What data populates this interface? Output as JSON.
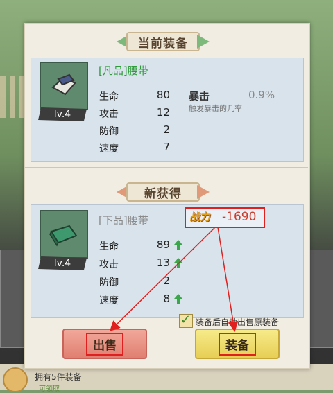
{
  "header": {
    "current_title": "当前装备",
    "new_title": "新获得"
  },
  "current_item": {
    "name": "[凡品]腰带",
    "name_color": "#2e9a3a",
    "level": "lv.4",
    "stats": [
      {
        "label": "生命",
        "value": "80"
      },
      {
        "label": "攻击",
        "value": "12"
      },
      {
        "label": "防御",
        "value": "2"
      },
      {
        "label": "速度",
        "value": "7"
      }
    ],
    "crit": {
      "label": "暴击",
      "value": "0.9%",
      "desc": "触发暴击的几率"
    }
  },
  "new_item": {
    "name": "[下品]腰带",
    "name_color": "#8a8a8a",
    "level": "lv.4",
    "power_label": "战力",
    "power_value": "-1690",
    "stats": [
      {
        "label": "生命",
        "value": "89",
        "icon": "up-arrow-icon"
      },
      {
        "label": "攻击",
        "value": "13",
        "icon": "up-arrow-icon"
      },
      {
        "label": "防御",
        "value": "2"
      },
      {
        "label": "速度",
        "value": "8",
        "icon": "up-arrow-icon"
      }
    ]
  },
  "auto_sell": {
    "label": "装备后自动出售原装备",
    "checked": true
  },
  "buttons": {
    "sell": "出售",
    "equip": "装备"
  },
  "footer": {
    "owned": "拥有5件装备",
    "sub": "可领取"
  },
  "colors": {
    "accent_red": "#e0201e",
    "up_green": "#3aa84a"
  }
}
